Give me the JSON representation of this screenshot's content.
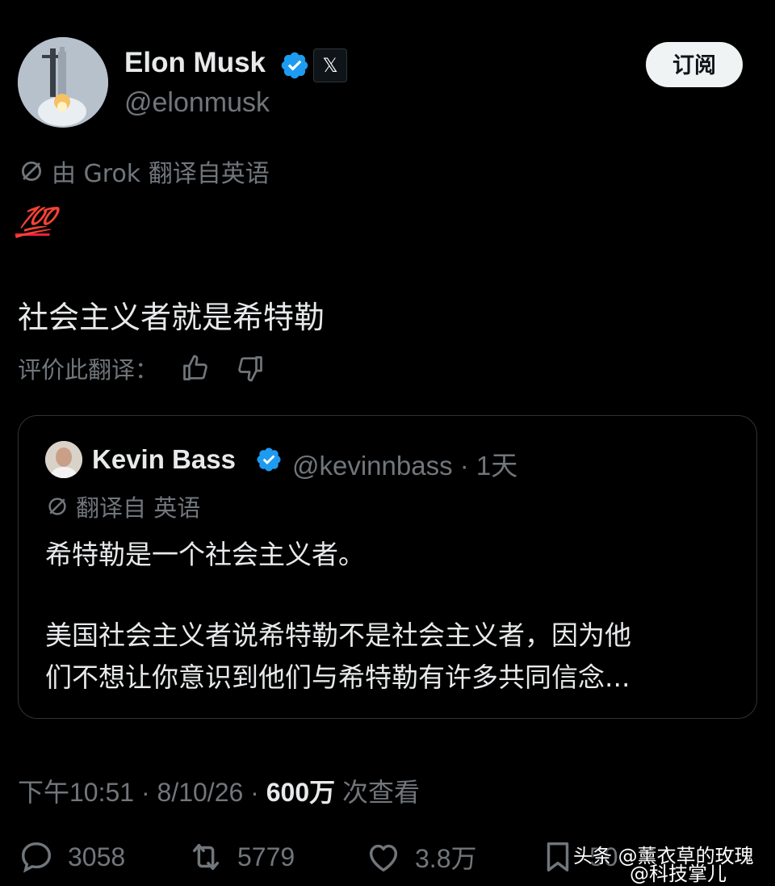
{
  "author": {
    "name": "Elon Musk",
    "handle": "@elonmusk",
    "platform_badge": "𝕏",
    "verified_color": "#1d9bf0"
  },
  "subscribe_label": "订阅",
  "translation": {
    "notice": "由 Grok 翻译自英语",
    "icon": "translate-icon"
  },
  "post": {
    "emoji": "💯",
    "text": "社会主义者就是希特勒"
  },
  "rate_translation": {
    "label": "评价此翻译：",
    "like_icon": "thumbs-up-icon",
    "dislike_icon": "thumbs-down-icon"
  },
  "quote": {
    "name": "Kevin Bass",
    "meta": "@kevinnbass · 1天",
    "translation_notice": "翻译自 英语",
    "lines": [
      "希特勒是一个社会主义者。",
      "美国社会主义者说希特勒不是社会主义者，因为他",
      "们不想让你意识到他们与希特勒有许多共同信念..."
    ]
  },
  "timestamp": {
    "time": "下午10:51 · 8/10/26 · ",
    "views_count": "600万",
    "views_label": " 次查看"
  },
  "actions": {
    "replies": "3058",
    "reposts": "5779",
    "likes": "3.8万",
    "bookmarks": "50"
  },
  "watermark": {
    "line1": "头条 @薰衣草的玫瑰",
    "line2": "@科技掌儿"
  },
  "colors": {
    "background": "#000000",
    "text_primary": "#e7e9ea",
    "text_secondary": "#71767b",
    "border": "#2f3336",
    "verified": "#1d9bf0"
  }
}
